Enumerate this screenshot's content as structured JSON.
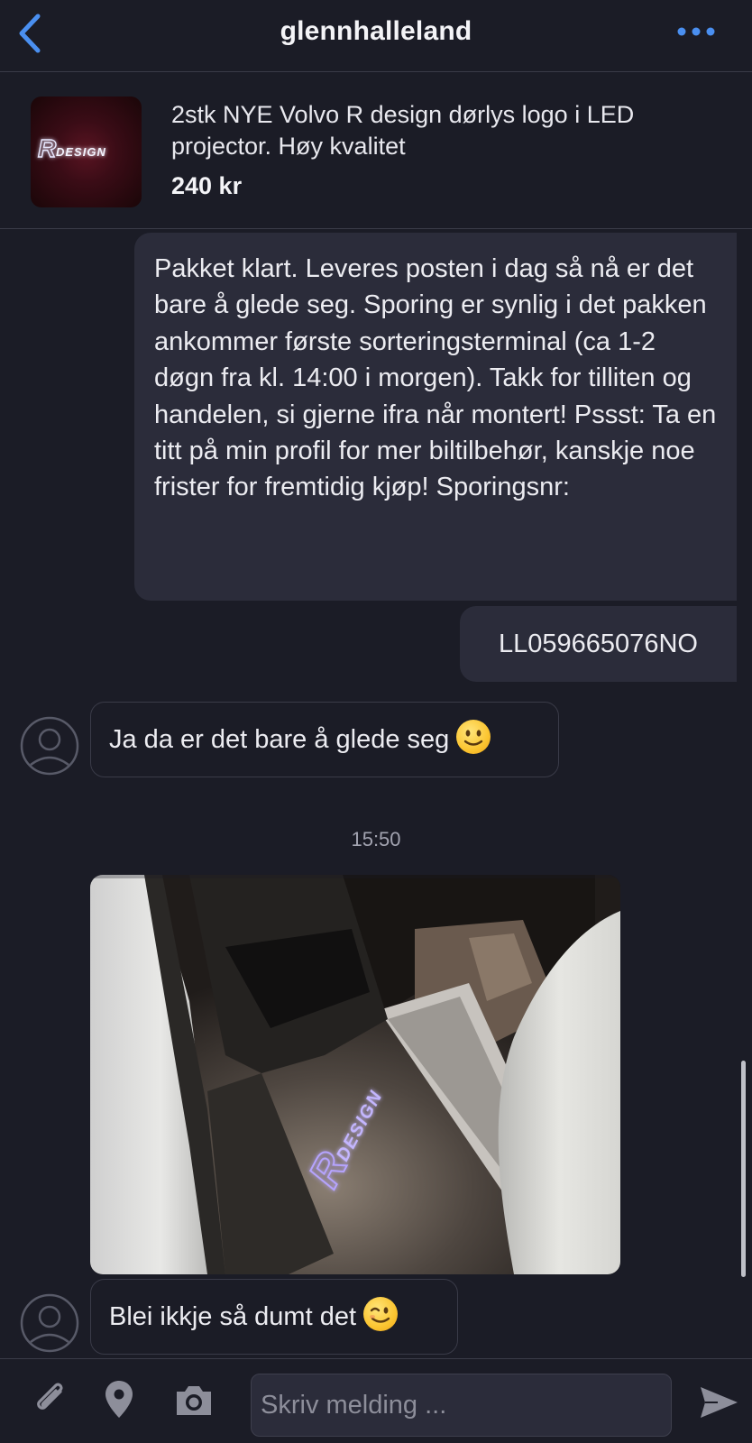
{
  "header": {
    "title": "glennhalleland",
    "back_icon": "chevron-left-icon",
    "more_icon": "more-horizontal-icon",
    "accent_color": "#4a8ff0"
  },
  "listing": {
    "thumbnail_logo_text": "RDESIGN",
    "title": "2stk NYE Volvo R design dørlys logo i LED projector. Høy kvalitet",
    "price": "240 kr"
  },
  "messages": [
    {
      "direction": "outgoing",
      "text": "Pakket klart. Leveres posten i dag så nå er det bare å glede seg.  Sporing er synlig i det pakken ankommer første sorteringsterminal (ca 1-2 døgn fra kl. 14:00 i morgen).  Takk for tilliten og handelen, si gjerne ifra når montert! Pssst: Ta en titt på min profil for mer biltilbehør, kanskje noe frister for fremtidig kjøp! Sporingsnr:"
    },
    {
      "direction": "outgoing",
      "text": "LL059665076NO"
    },
    {
      "direction": "incoming",
      "text": "Ja da er det bare å glede seg",
      "emoji": "slightly-smiling-face"
    },
    {
      "direction": "incoming",
      "type": "photo",
      "photo_logo_text": "RDESIGN"
    },
    {
      "direction": "incoming",
      "text": "Blei ikkje så dumt det",
      "emoji": "winking-face"
    }
  ],
  "timestamp": "15:50",
  "composer": {
    "placeholder": "Skriv melding ...",
    "value": "",
    "icons": [
      "paperclip-icon",
      "location-pin-icon",
      "camera-icon",
      "send-icon"
    ]
  }
}
